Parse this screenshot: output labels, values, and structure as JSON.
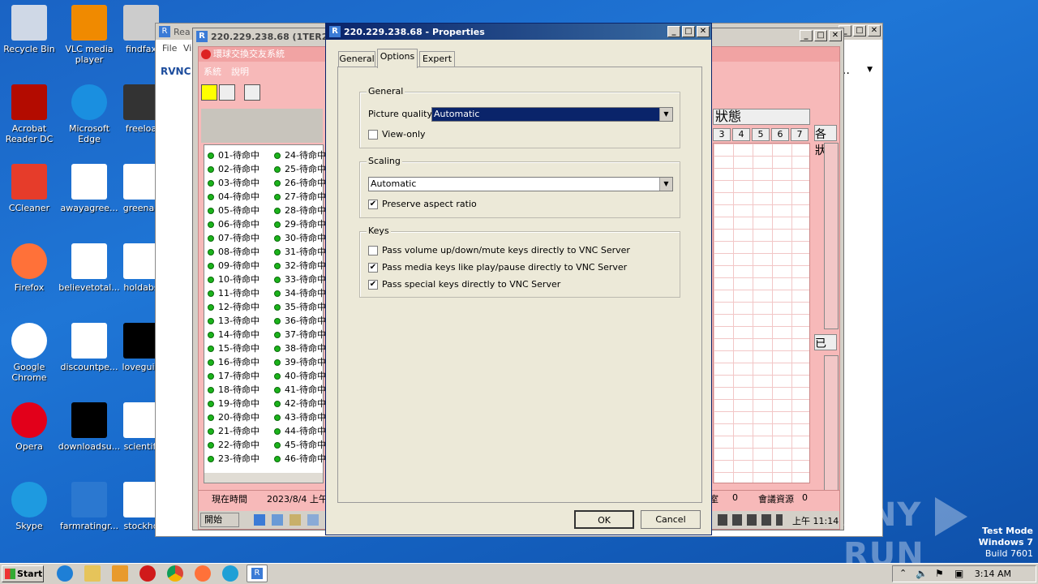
{
  "desktop": {
    "icons": [
      {
        "label": "Recycle Bin"
      },
      {
        "label": "VLC media player"
      },
      {
        "label": "findfax"
      },
      {
        "label": "Acrobat Reader DC"
      },
      {
        "label": "Microsoft Edge"
      },
      {
        "label": "freeloa"
      },
      {
        "label": "CCleaner"
      },
      {
        "label": "awayagree..."
      },
      {
        "label": "greenac"
      },
      {
        "label": "Firefox"
      },
      {
        "label": "believetotal..."
      },
      {
        "label": "holdabs"
      },
      {
        "label": "Google Chrome"
      },
      {
        "label": "discountpe..."
      },
      {
        "label": "loveguid"
      },
      {
        "label": "Opera"
      },
      {
        "label": "downloadsu..."
      },
      {
        "label": "scientifi"
      },
      {
        "label": "Skype"
      },
      {
        "label": "farmratingr..."
      },
      {
        "label": "stockho"
      }
    ]
  },
  "rvnc_window": {
    "title": "Rea",
    "menu_file": "File",
    "menu_view": "Vi",
    "logo": "RVNC"
  },
  "session_window": {
    "title": "220.229.238.68 (1TER2)",
    "inner_title": "環球交換交友系統",
    "menu_system": "系統",
    "menu_help": "說明",
    "status_header": "狀態",
    "col_numbers": [
      "3",
      "4",
      "5",
      "6",
      "7"
    ],
    "col_side_label": "各狀",
    "col_side_label2": "已",
    "lines_left": [
      "01-待命中",
      "02-待命中",
      "03-待命中",
      "04-待命中",
      "05-待命中",
      "06-待命中",
      "07-待命中",
      "08-待命中",
      "09-待命中",
      "10-待命中",
      "11-待命中",
      "12-待命中",
      "13-待命中",
      "14-待命中",
      "15-待命中",
      "16-待命中",
      "17-待命中",
      "18-待命中",
      "19-待命中",
      "20-待命中",
      "21-待命中",
      "22-待命中",
      "23-待命中"
    ],
    "lines_right": [
      "24-待命中",
      "25-待命中",
      "26-待命中",
      "27-待命中",
      "28-待命中",
      "29-待命中",
      "30-待命中",
      "31-待命中",
      "32-待命中",
      "33-待命中",
      "34-待命中",
      "35-待命中",
      "36-待命中",
      "37-待命中",
      "38-待命中",
      "39-待命中",
      "40-待命中",
      "41-待命中",
      "42-待命中",
      "43-待命中",
      "44-待命中",
      "45-待命中",
      "46-待命中"
    ],
    "status_time_label": "現在時間",
    "status_time_value": "2023/8/4 上午",
    "status_room_label": "室",
    "status_room_value": "0",
    "status_res_label": "會議資源",
    "status_res_value": "0",
    "start_label": "開始",
    "clock": "上午 11:14"
  },
  "dialog": {
    "title": "220.229.238.68 - Properties",
    "tabs": [
      "General",
      "Options",
      "Expert"
    ],
    "active_tab": "Options",
    "general_group": "General",
    "picture_quality_label": "Picture quality:",
    "picture_quality_value": "Automatic",
    "view_only_label": "View-only",
    "view_only_checked": false,
    "scaling_group": "Scaling",
    "scaling_value": "Automatic",
    "preserve_label": "Preserve aspect ratio",
    "preserve_checked": true,
    "keys_group": "Keys",
    "key_volume_label": "Pass volume up/down/mute keys directly to VNC Server",
    "key_volume_checked": false,
    "key_media_label": "Pass media keys like play/pause directly to VNC Server",
    "key_media_checked": true,
    "key_special_label": "Pass special keys directly to VNC Server",
    "key_special_checked": true,
    "ok_label": "OK",
    "cancel_label": "Cancel"
  },
  "watermark": {
    "text": "ANY",
    "text2": "RUN",
    "mode": "Test Mode",
    "os": "Windows 7",
    "build": "Build 7601"
  },
  "taskbar": {
    "start_label": "Start",
    "clock": "3:14 AM"
  },
  "colors": {
    "accent": "#0a246a",
    "pink": "#f7b9b9",
    "desktop": "#1f76d6"
  }
}
